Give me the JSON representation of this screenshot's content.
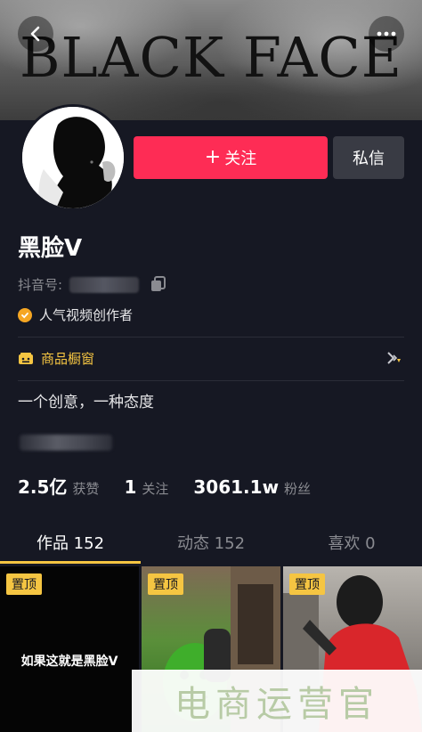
{
  "banner": {
    "title": "BLACK  FACE"
  },
  "icons": {
    "back": "chevron-left-icon",
    "more": "more-dots-icon",
    "copy": "copy-icon",
    "verified": "check-icon",
    "shop": "shop-icon",
    "arrow": "chevron-right-icon"
  },
  "profile": {
    "follow_label": "关注",
    "message_label": "私信",
    "name": "黑脸V",
    "douyin_label": "抖音号:",
    "badge": "人气视频创作者",
    "shop_label": "商品橱窗",
    "bio": "一个创意，一种态度"
  },
  "stats": [
    {
      "value": "2.5亿",
      "label": "获赞"
    },
    {
      "value": "1",
      "label": "关注"
    },
    {
      "value": "3061.1w",
      "label": "粉丝"
    }
  ],
  "tabs": [
    {
      "label": "作品 152",
      "active": true
    },
    {
      "label": "动态 152",
      "active": false
    },
    {
      "label": "喜欢 0",
      "active": false
    }
  ],
  "videos": [
    {
      "pinned": "置顶",
      "caption": "如果这就是黑脸V"
    },
    {
      "pinned": "置顶",
      "caption": ""
    },
    {
      "pinned": "置顶",
      "caption": ""
    }
  ],
  "watermark": "电商运营官",
  "colors": {
    "accent": "#fe2c55",
    "highlight": "#f5c542",
    "background": "#161823"
  }
}
